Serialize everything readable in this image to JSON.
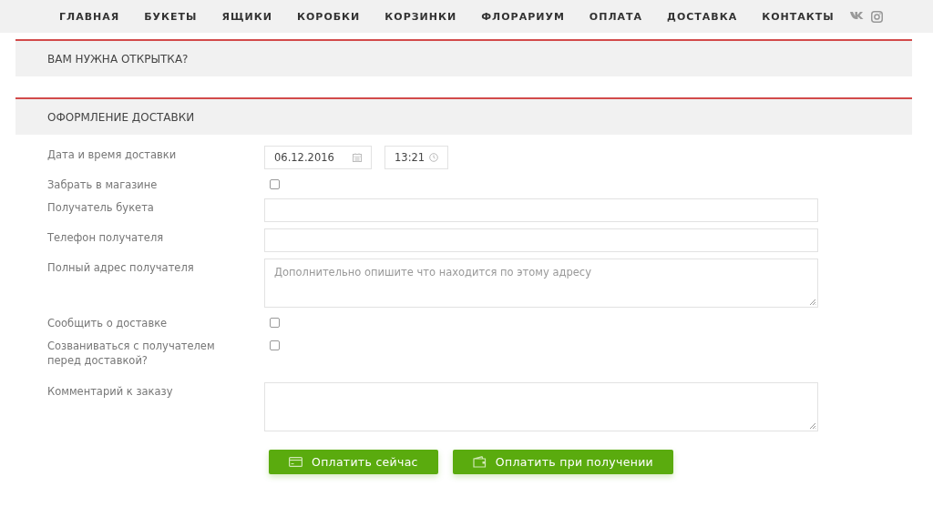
{
  "nav": {
    "items": [
      {
        "label": "ГЛАВНАЯ"
      },
      {
        "label": "БУКЕТЫ"
      },
      {
        "label": "ЯЩИКИ"
      },
      {
        "label": "КОРОБКИ"
      },
      {
        "label": "КОРЗИНКИ"
      },
      {
        "label": "ФЛОРАРИУМ"
      },
      {
        "label": "ОПЛАТА"
      },
      {
        "label": "ДОСТАВКА"
      },
      {
        "label": "КОНТАКТЫ"
      }
    ]
  },
  "sections": [
    {
      "title": "ВАМ НУЖНА ОТКРЫТКА?"
    },
    {
      "title": "ОФОРМЛЕНИЕ ДОСТАВКИ"
    }
  ],
  "form": {
    "rows": [
      {
        "kind": "datetime",
        "label": "Дата и время доставки",
        "date": "06.12.2016",
        "time": "13:21"
      },
      {
        "kind": "checkbox",
        "label": "Забрать в магазине",
        "checked": false
      },
      {
        "kind": "text",
        "label": "Получатель букета"
      },
      {
        "kind": "text",
        "label": "Телефон получателя"
      },
      {
        "kind": "textarea",
        "label": "Полный адрес получателя",
        "placeholder": "Дополнительно опишите что находится по этому адресу"
      },
      {
        "kind": "checkbox",
        "label": "Сообщить о доставке",
        "checked": false
      },
      {
        "kind": "checkbox",
        "label": "Созваниваться с получателем перед доставкой?",
        "checked": false
      },
      {
        "kind": "textarea",
        "label": "Комментарий к заказу"
      }
    ]
  },
  "buttons": [
    {
      "kind": "card",
      "label": "Оплатить сейчас"
    },
    {
      "kind": "wallet",
      "label": "Оплатить при получении"
    }
  ]
}
